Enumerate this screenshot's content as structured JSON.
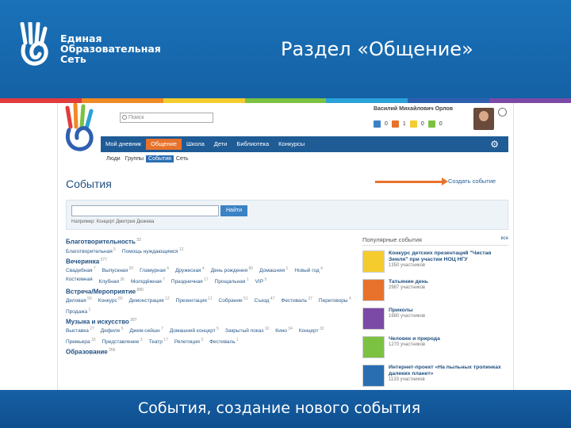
{
  "slide": {
    "logo_lines": [
      "Единая",
      "Образовательная",
      "Сеть"
    ],
    "title": "Раздел «Общение»",
    "caption": "События, создание нового события",
    "colors": {
      "header": "#1a72b8",
      "accent": "#e8722c",
      "rainbow": [
        "#e23b3b",
        "#f08a24",
        "#f4cc2e",
        "#7cc242",
        "#2aa1d9",
        "#2f5fb0",
        "#7b4aa6"
      ]
    }
  },
  "topbar": {
    "search_placeholder": "Поиск",
    "user_name": "Василий Михайлович Орлов",
    "counters": [
      "0",
      "1",
      "0",
      "0"
    ]
  },
  "nav": {
    "items": [
      "Мой дневник",
      "Общение",
      "Школа",
      "Дети",
      "Библиотека",
      "Конкурсы"
    ],
    "active": "Общение"
  },
  "subnav": {
    "items": [
      "Люди",
      "Группы",
      "События",
      "Сеть"
    ],
    "active": "События"
  },
  "page": {
    "title": "События",
    "create_link": "Создать событие",
    "search_button": "Найти",
    "search_hint": "Например: Концерт Дмитрия Дюжева"
  },
  "categories": [
    {
      "title": "Благотворительность",
      "count": "33",
      "items": [
        [
          "Благотворительная",
          "5"
        ],
        [
          "Помощь нуждающимся",
          "12"
        ]
      ]
    },
    {
      "title": "Вечеринка",
      "count": "277",
      "items": [
        [
          "Свадебная",
          "7"
        ],
        [
          "Выпускная",
          "20"
        ],
        [
          "Гламурная",
          "4"
        ],
        [
          "Дружеская",
          "4"
        ],
        [
          "День рождения",
          "80"
        ],
        [
          "Домашняя",
          "1"
        ],
        [
          "Новый год",
          "4"
        ],
        [
          "Костюмная",
          ""
        ],
        [
          "Клубная",
          "36"
        ],
        [
          "Молодёжная",
          "7"
        ],
        [
          "Праздничная",
          "17"
        ],
        [
          "Прощальная",
          "1"
        ],
        [
          "VIP",
          "5"
        ]
      ]
    },
    {
      "title": "Встреча/Мероприятие",
      "count": "680",
      "items": [
        [
          "Деловая",
          "56"
        ],
        [
          "Конкурс",
          "80"
        ],
        [
          "Демонстрация",
          "12"
        ],
        [
          "Презентация",
          "11"
        ],
        [
          "Собрание",
          "51"
        ],
        [
          "Съезд",
          "47"
        ],
        [
          "Фестиваль",
          "37"
        ],
        [
          "Переговоры",
          "4"
        ],
        [
          "Продажа",
          "1"
        ]
      ]
    },
    {
      "title": "Музыка и искусство",
      "count": "307",
      "items": [
        [
          "Выставка",
          "27"
        ],
        [
          "Дефиле",
          "5"
        ],
        [
          "Джем-сейшн",
          "7"
        ],
        [
          "Домашний концерт",
          "5"
        ],
        [
          "Закрытый показ",
          "10"
        ],
        [
          "Кино",
          "34"
        ],
        [
          "Концерт",
          "32"
        ],
        [
          "Премьера",
          "33"
        ],
        [
          "Представление",
          "3"
        ],
        [
          "Театр",
          "17"
        ],
        [
          "Репетиция",
          "3"
        ],
        [
          "Фестиваль",
          "1"
        ]
      ]
    },
    {
      "title": "Образование",
      "count": "256",
      "items": []
    }
  ],
  "popular": {
    "heading": "Популярные события",
    "all_link": "все",
    "items": [
      {
        "title": "Конкурс детских презентаций \"Чистая Земля\" при участии НОЦ НГУ",
        "sub": "1350 участников"
      },
      {
        "title": "Татьянин день",
        "sub": "2987 участников"
      },
      {
        "title": "Приколы",
        "sub": "1680 участников"
      },
      {
        "title": "Человек и природа",
        "sub": "1270 участников"
      },
      {
        "title": "Интернет-проект «На пыльных тропинках далеких планет»",
        "sub": "1133 участников"
      }
    ]
  }
}
